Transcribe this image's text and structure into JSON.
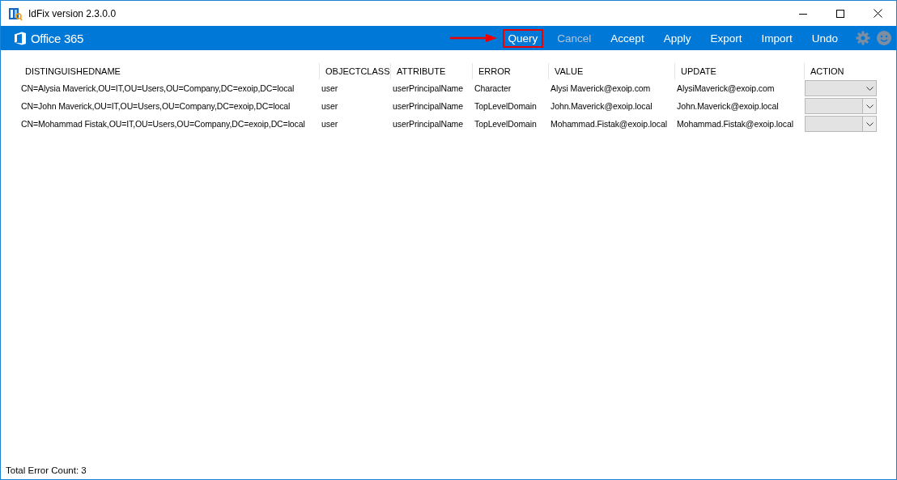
{
  "window": {
    "title": "IdFix version 2.3.0.0"
  },
  "brand": {
    "label": "Office 365"
  },
  "menu": [
    {
      "label": "Query",
      "disabled": false,
      "highlighted": true
    },
    {
      "label": "Cancel",
      "disabled": true,
      "highlighted": false
    },
    {
      "label": "Accept",
      "disabled": false,
      "highlighted": false
    },
    {
      "label": "Apply",
      "disabled": false,
      "highlighted": false
    },
    {
      "label": "Export",
      "disabled": false,
      "highlighted": false
    },
    {
      "label": "Import",
      "disabled": false,
      "highlighted": false
    },
    {
      "label": "Undo",
      "disabled": false,
      "highlighted": false
    }
  ],
  "table": {
    "columns": [
      "DISTINGUISHEDNAME",
      "OBJECTCLASS",
      "ATTRIBUTE",
      "ERROR",
      "VALUE",
      "UPDATE",
      "ACTION"
    ],
    "rows": [
      {
        "cells": [
          "CN=Alysia Maverick,OU=IT,OU=Users,OU=Company,DC=exoip,DC=local",
          "user",
          "userPrincipalName",
          "Character",
          "Alysi Maverick@exoip.com",
          "AlysiMaverick@exoip.com"
        ],
        "action": {
          "kind": "flat"
        }
      },
      {
        "cells": [
          "CN=John Maverick,OU=IT,OU=Users,OU=Company,DC=exoip,DC=local",
          "user",
          "userPrincipalName",
          "TopLevelDomain",
          "John.Maverick@exoip.local",
          "John.Maverick@exoip.local"
        ],
        "action": {
          "kind": "split"
        }
      },
      {
        "cells": [
          "CN=Mohammad Fistak,OU=IT,OU=Users,OU=Company,DC=exoip,DC=local",
          "user",
          "userPrincipalName",
          "TopLevelDomain",
          "Mohammad.Fistak@exoip.local",
          "Mohammad.Fistak@exoip.local"
        ],
        "action": {
          "kind": "split"
        }
      }
    ]
  },
  "status_bar": {
    "text": "Total Error Count: 3"
  }
}
